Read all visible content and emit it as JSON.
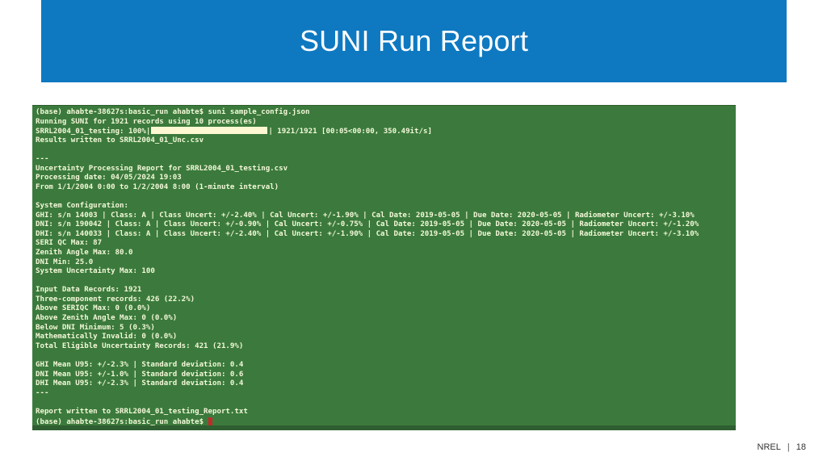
{
  "slide": {
    "title": "SUNI Run Report",
    "footer_org": "NREL",
    "footer_sep": "|",
    "page_number": "18"
  },
  "terminal": {
    "prompt_cmd": "(base) ahabte-38627s:basic_run ahabte$ suni sample_config.json",
    "running": "Running SUNI for 1921 records using 10 process(es)",
    "progress_prefix": "SRRL2004_01_testing: 100%|",
    "progress_suffix": "| 1921/1921 [00:05<00:00, 350.49it/s]",
    "progress_percent": 100,
    "results_written": "Results written to SRRL2004_01_Unc.csv",
    "blank1": "",
    "sep1": "---",
    "report_title": "Uncertainty Processing Report for SRRL2004_01_testing.csv",
    "processing_date": "Processing date: 04/05/2024 19:03",
    "from_range": "From 1/1/2004 0:00 to 1/2/2004 8:00 (1-minute interval)",
    "blank2": "",
    "sys_config": "System Configuration:",
    "ghi": "GHI: s/n 14003 | Class: A | Class Uncert: +/-2.40% | Cal Uncert: +/-1.90% | Cal Date: 2019-05-05 | Due Date: 2020-05-05 | Radiometer Uncert: +/-3.10%",
    "dni": "DNI: s/n 190042 | Class: A | Class Uncert: +/-0.90% | Cal Uncert: +/-0.75% | Cal Date: 2019-05-05 | Due Date: 2020-05-05 | Radiometer Uncert: +/-1.20%",
    "dhi": "DHI: s/n 140033 | Class: A | Class Uncert: +/-2.40% | Cal Uncert: +/-1.90% | Cal Date: 2019-05-05 | Due Date: 2020-05-05 | Radiometer Uncert: +/-3.10%",
    "seri_qc": "SERI QC Max: 87",
    "zenith_max": "Zenith Angle Max: 80.0",
    "dni_min": "DNI Min: 25.0",
    "sys_unc_max": "System Uncertainty Max: 100",
    "blank3": "",
    "input_records": "Input Data Records: 1921",
    "three_comp": "Three-component records: 426 (22.2%)",
    "above_seriqc": "Above SERIQC Max: 0 (0.0%)",
    "above_zenith": "Above Zenith Angle Max: 0 (0.0%)",
    "below_dni": "Below DNI Minimum: 5 (0.3%)",
    "math_invalid": "Mathematically Invalid: 0 (0.0%)",
    "total_eligible": "Total Eligible Uncertainty Records: 421 (21.9%)",
    "blank4": "",
    "ghi_mean": "GHI Mean U95: +/-2.3% | Standard deviation: 0.4",
    "dni_mean": "DNI Mean U95: +/-1.0% | Standard deviation: 0.6",
    "dhi_mean": "DHI Mean U95: +/-2.3% | Standard deviation: 0.4",
    "sep2": "---",
    "blank5": "",
    "report_written": "Report written to SRRL2004_01_testing_Report.txt",
    "final_prompt": "(base) ahabte-38627s:basic_run ahabte$"
  },
  "colors": {
    "banner": "#0e79c1",
    "terminal_bg": "#3b7a3c",
    "terminal_text": "#f3f8d9",
    "progress_fill": "#fdf8d2",
    "cursor": "#c62828"
  }
}
